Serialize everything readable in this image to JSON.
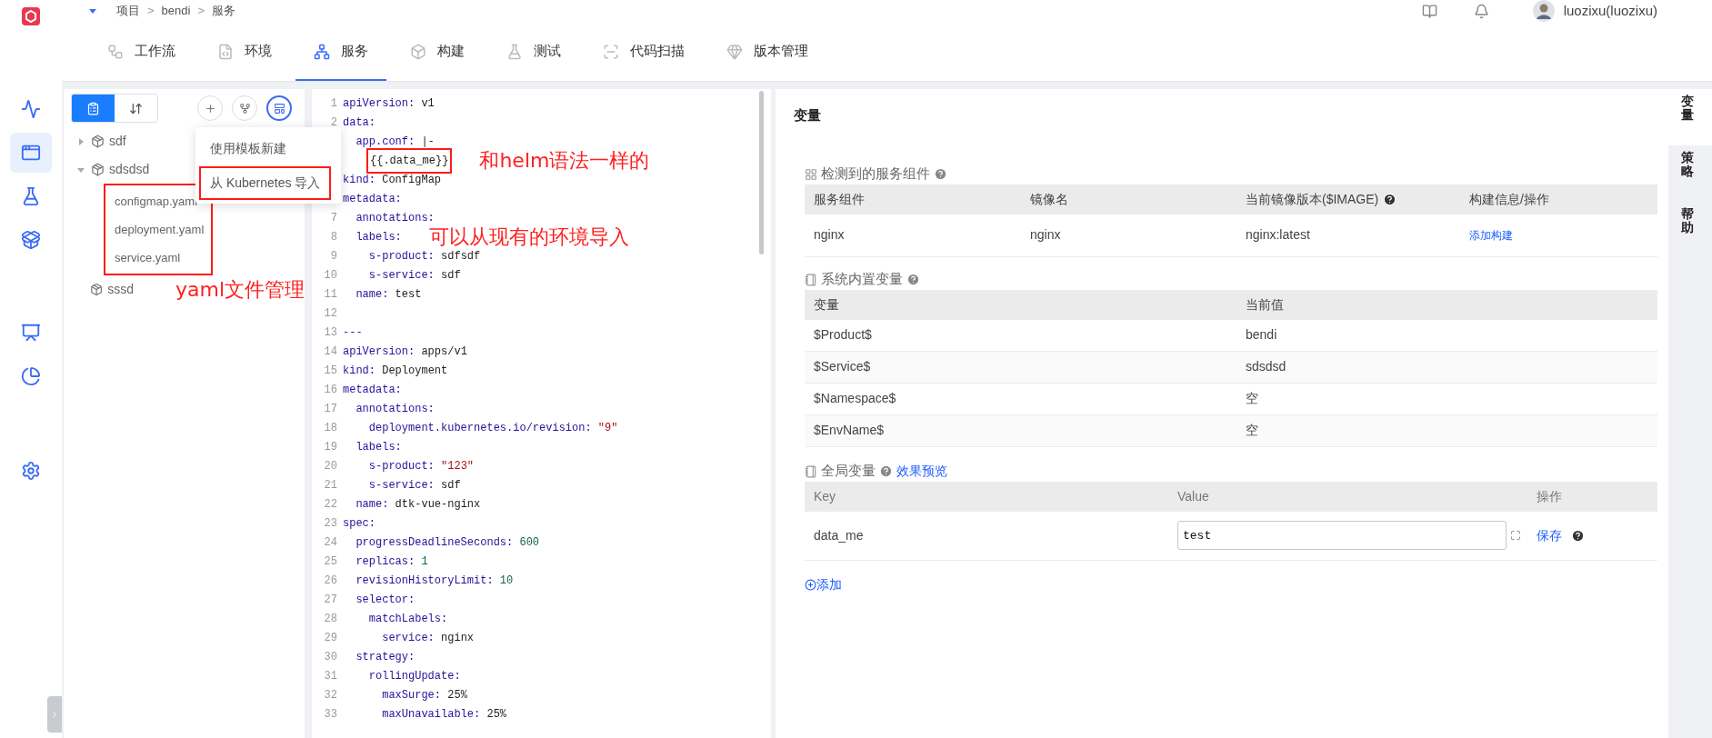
{
  "breadcrumb": [
    "项目",
    ">",
    "bendi",
    ">",
    "服务"
  ],
  "user": {
    "name": "luozixu(luozixu)"
  },
  "sidebar": {
    "groups": [
      [
        {
          "kind": "monitor",
          "selected": false
        },
        {
          "kind": "project",
          "selected": true
        },
        {
          "kind": "test",
          "selected": false
        },
        {
          "kind": "delivery",
          "selected": false
        }
      ],
      [
        {
          "kind": "dashboard",
          "selected": false
        },
        {
          "kind": "insight",
          "selected": false
        }
      ],
      [
        {
          "kind": "settings",
          "selected": false
        }
      ]
    ]
  },
  "tabs": [
    {
      "label": "工作流",
      "kind": "workflow",
      "selected": false
    },
    {
      "label": "环境",
      "kind": "environment",
      "selected": false
    },
    {
      "label": "服务",
      "kind": "service",
      "selected": true
    },
    {
      "label": "构建",
      "kind": "build",
      "selected": false
    },
    {
      "label": "测试",
      "kind": "test",
      "selected": false
    },
    {
      "label": "代码扫描",
      "kind": "scan",
      "selected": false
    },
    {
      "label": "版本管理",
      "kind": "version",
      "selected": false
    }
  ],
  "tree": {
    "view_modes": [
      {
        "kind": "list",
        "selected": true
      },
      {
        "kind": "sort",
        "selected": false
      }
    ],
    "actions": [
      {
        "kind": "add",
        "selected": false
      },
      {
        "kind": "branch",
        "selected": false
      },
      {
        "kind": "template",
        "selected": true
      }
    ],
    "items": [
      {
        "label": "sdf",
        "expandable": true,
        "expanded": false
      },
      {
        "label": "sdsdsd",
        "expandable": true,
        "expanded": true,
        "children_annotated": true,
        "children": [
          {
            "label": "configmap.yaml"
          },
          {
            "label": "deployment.yaml"
          },
          {
            "label": "service.yaml"
          }
        ]
      },
      {
        "label": "sssd",
        "note": "yaml文件管理"
      }
    ]
  },
  "menu": {
    "items": [
      {
        "label": "使用模板新建",
        "annotated": false
      },
      {
        "label": "从 Kubernetes 导入",
        "annotated": true
      }
    ]
  },
  "code": [
    {
      "n": "1",
      "kind": "pair",
      "key": "apiVersion:",
      "value": "v1"
    },
    {
      "n": "2",
      "kind": "pair",
      "key": "data:"
    },
    {
      "kind": "pair",
      "key": "  app.conf:",
      "value": "|-"
    },
    {
      "kind": "template",
      "text": "{{.data_me}}",
      "annotated": true,
      "note": "和helm语法一样的"
    },
    {
      "kind": "pair",
      "key": "kind:",
      "value": "ConfigMap"
    },
    {
      "kind": "pair",
      "key": "metadata:"
    },
    {
      "n": "7",
      "kind": "pair",
      "key": "  annotations:"
    },
    {
      "n": "8",
      "kind": "pair",
      "key": "  labels:",
      "note": "可以从现有的环境导入"
    },
    {
      "n": "9",
      "kind": "pair",
      "key": "    s-product:",
      "value": "sdfsdf"
    },
    {
      "n": "10",
      "kind": "pair",
      "key": "    s-service:",
      "value": "sdf"
    },
    {
      "n": "11",
      "kind": "pair",
      "key": "  name:",
      "value": "test"
    },
    {
      "n": "12",
      "kind": "blank"
    },
    {
      "n": "13",
      "kind": "rule",
      "text": "---"
    },
    {
      "n": "14",
      "kind": "pair",
      "key": "apiVersion:",
      "value": "apps/v1"
    },
    {
      "n": "15",
      "kind": "pair",
      "key": "kind:",
      "value": "Deployment"
    },
    {
      "n": "16",
      "kind": "pair",
      "key": "metadata:"
    },
    {
      "n": "17",
      "kind": "pair",
      "key": "  annotations:"
    },
    {
      "n": "18",
      "kind": "pair",
      "key": "    deployment.kubernetes.io/revision:",
      "string": "\"9\""
    },
    {
      "n": "19",
      "kind": "pair",
      "key": "  labels:"
    },
    {
      "n": "20",
      "kind": "pair",
      "key": "    s-product:",
      "string": "\"123\""
    },
    {
      "n": "21",
      "kind": "pair",
      "key": "    s-service:",
      "value": "sdf"
    },
    {
      "n": "22",
      "kind": "pair",
      "key": "  name:",
      "value": "dtk-vue-nginx"
    },
    {
      "n": "23",
      "kind": "pair",
      "key": "spec:"
    },
    {
      "n": "24",
      "kind": "pair",
      "key": "  progressDeadlineSeconds:",
      "number": "600"
    },
    {
      "n": "25",
      "kind": "pair",
      "key": "  replicas:",
      "number": "1"
    },
    {
      "n": "26",
      "kind": "pair",
      "key": "  revisionHistoryLimit:",
      "number": "10"
    },
    {
      "n": "27",
      "kind": "pair",
      "key": "  selector:"
    },
    {
      "n": "28",
      "kind": "pair",
      "key": "    matchLabels:"
    },
    {
      "n": "29",
      "kind": "pair",
      "key": "      service:",
      "value": "nginx"
    },
    {
      "n": "30",
      "kind": "pair",
      "key": "  strategy:"
    },
    {
      "n": "31",
      "kind": "pair",
      "key": "    rollingUpdate:"
    },
    {
      "n": "32",
      "kind": "pair",
      "key": "      maxSurge:",
      "value": "25%"
    },
    {
      "n": "33",
      "kind": "pair",
      "key": "      maxUnavailable:",
      "value": "25%"
    }
  ],
  "variables": {
    "title": "变量",
    "components": {
      "title": "检测到的服务组件",
      "columns": [
        {
          "label": "服务组件",
          "help": false
        },
        {
          "label": "镜像名",
          "help": false
        },
        {
          "label": "当前镜像版本($IMAGE)",
          "help": true
        },
        {
          "label": "构建信息/操作",
          "help": false
        }
      ],
      "rows": [
        {
          "cells": [
            "nginx",
            "nginx",
            "nginx:latest"
          ],
          "action": "添加构建"
        }
      ]
    },
    "system": {
      "title": "系统内置变量",
      "columns": [
        "变量",
        "当前值"
      ],
      "rows": [
        [
          "$Product$",
          "bendi"
        ],
        [
          "$Service$",
          "sdsdsd"
        ],
        [
          "$Namespace$",
          "空"
        ],
        [
          "$EnvName$",
          "空"
        ]
      ]
    },
    "global": {
      "title": "全局变量",
      "link": "效果预览",
      "columns": [
        "Key",
        "Value",
        "操作"
      ],
      "rows": [
        {
          "key": "data_me",
          "value": "test",
          "action": "保存"
        }
      ],
      "add": "添加"
    }
  },
  "side_tabs": [
    {
      "label": "变量",
      "selected": true
    },
    {
      "label": "策略",
      "selected": false
    },
    {
      "label": "帮助",
      "selected": false
    }
  ]
}
